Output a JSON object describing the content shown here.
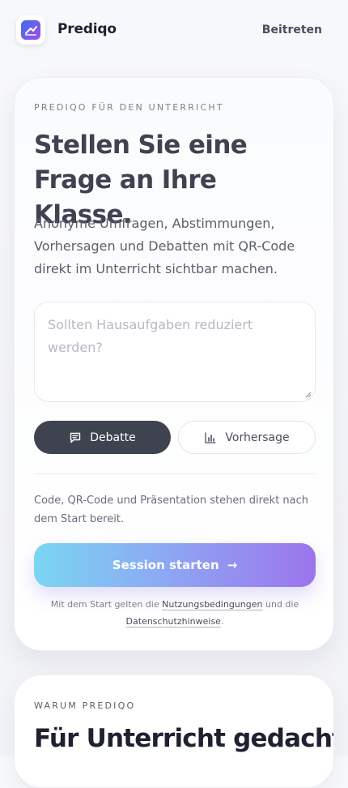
{
  "header": {
    "brand": "Prediqo",
    "join_label": "Beitreten"
  },
  "hero": {
    "eyebrow": "PREDIQO FÜR DEN UNTERRICHT",
    "headline": "Stellen Sie eine Frage an Ihre Klasse.",
    "lead": "Anonyme Umfragen, Abstimmungen, Vorhersagen und Debatten mit QR-Code direkt im Unterricht sichtbar machen.",
    "question_placeholder": "Sollten Hausaufgaben reduziert werden?",
    "question_value": "",
    "modes": [
      {
        "label": "Debatte",
        "icon": "chat-icon",
        "selected": true
      },
      {
        "label": "Vorhersage",
        "icon": "bar-chart-icon",
        "selected": false
      }
    ],
    "info": "Code, QR-Code und Präsentation stehen direkt nach dem Start bereit.",
    "cta_label": "Session starten",
    "legal": {
      "prefix": "Mit dem Start gelten die",
      "terms_link": "Nutzungsbedingungen",
      "middle": "und die",
      "privacy_link": "Datenschutzhinweise",
      "suffix": "."
    }
  },
  "why": {
    "eyebrow": "WARUM PREDIQO",
    "headline": "Für Unterricht gedacht,"
  },
  "colors": {
    "primary_dark": "#3f424f",
    "cta_gradient_start": "#7ad6f2",
    "cta_gradient_end": "#9c74ec",
    "logo_gradient_start": "#3b6ff0",
    "logo_gradient_end": "#a24de3"
  }
}
